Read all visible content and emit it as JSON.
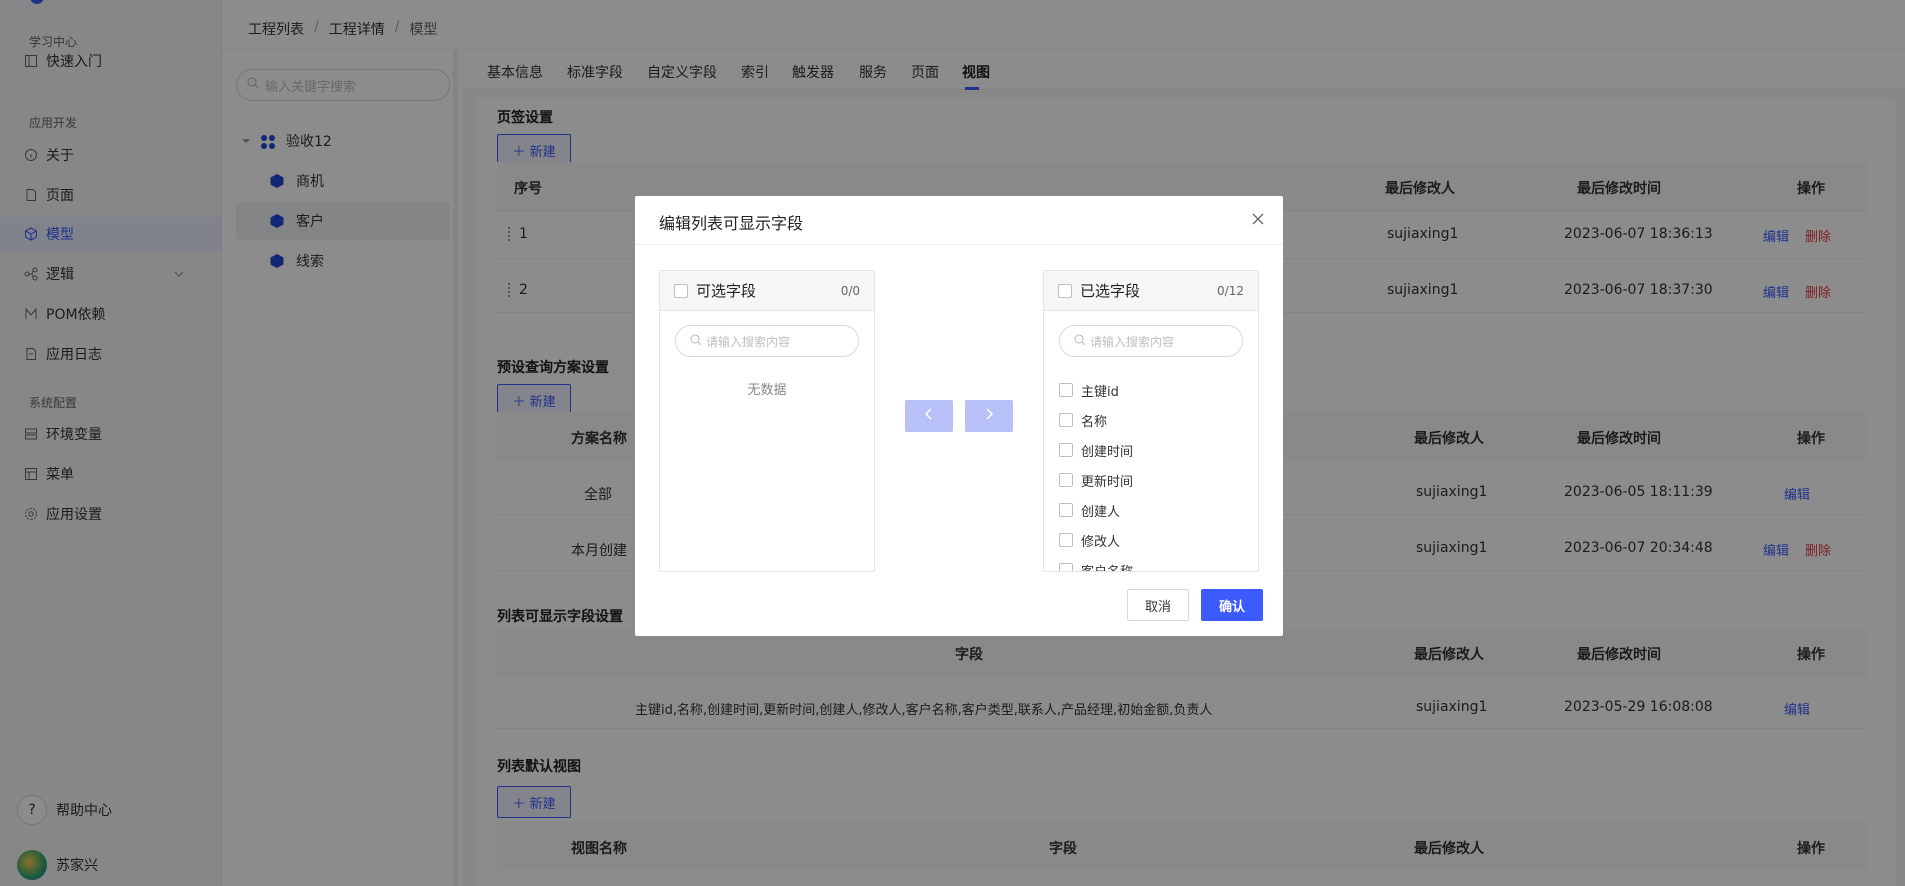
{
  "colors": {
    "accent": "#3b5bff",
    "danger": "#e63946"
  },
  "sidebar": {
    "groups": [
      {
        "label": "学习中心"
      },
      {
        "label": "应用开发"
      },
      {
        "label": "系统配置"
      }
    ],
    "items": [
      {
        "label": "快速入门",
        "icon": "book-icon"
      },
      {
        "label": "关于",
        "icon": "info-circle-icon"
      },
      {
        "label": "页面",
        "icon": "page-icon"
      },
      {
        "label": "模型",
        "icon": "cube-icon"
      },
      {
        "label": "逻辑",
        "icon": "logic-icon"
      },
      {
        "label": "POM依赖",
        "icon": "m-icon"
      },
      {
        "label": "应用日志",
        "icon": "log-icon"
      },
      {
        "label": "环境变量",
        "icon": "env-icon"
      },
      {
        "label": "菜单",
        "icon": "menu-icon"
      },
      {
        "label": "应用设置",
        "icon": "gear-icon"
      }
    ],
    "help": "帮助中心",
    "user": "苏家兴"
  },
  "breadcrumb": {
    "a": "工程列表",
    "b": "工程详情",
    "c": "模型",
    "sep": "/"
  },
  "tree": {
    "search_placeholder": "输入关键字搜索",
    "root": "验收12",
    "children": [
      "商机",
      "客户",
      "线索"
    ]
  },
  "tabs": [
    "基本信息",
    "标准字段",
    "自定义字段",
    "索引",
    "触发器",
    "服务",
    "页面",
    "视图"
  ],
  "sections": {
    "tab_settings": {
      "title": "页签设置",
      "new_btn": "新建",
      "headers": {
        "no": "序号",
        "modifier": "最后修改人",
        "time": "最后修改时间",
        "op": "操作"
      },
      "rows": [
        {
          "no": "1",
          "modifier": "sujiaxing1",
          "time": "2023-06-07 18:36:13",
          "edit": "编辑",
          "del": "删除"
        },
        {
          "no": "2",
          "modifier": "sujiaxing1",
          "time": "2023-06-07 18:37:30",
          "edit": "编辑",
          "del": "删除"
        }
      ]
    },
    "query_plans": {
      "title": "预设查询方案设置",
      "new_btn": "新建",
      "headers": {
        "name": "方案名称",
        "modifier": "最后修改人",
        "time": "最后修改时间",
        "op": "操作"
      },
      "rows": [
        {
          "name": "全部",
          "modifier": "sujiaxing1",
          "time": "2023-06-05 18:11:39",
          "edit": "编辑"
        },
        {
          "name": "本月创建",
          "modifier": "sujiaxing1",
          "time": "2023-06-07 20:34:48",
          "edit": "编辑",
          "del": "删除"
        }
      ]
    },
    "list_fields": {
      "title": "列表可显示字段设置",
      "headers": {
        "field": "字段",
        "modifier": "最后修改人",
        "time": "最后修改时间",
        "op": "操作"
      },
      "row": {
        "field": "主键id,名称,创建时间,更新时间,创建人,修改人,客户名称,客户类型,联系人,产品经理,初始金额,负责人",
        "modifier": "sujiaxing1",
        "time": "2023-05-29 16:08:08",
        "edit": "编辑"
      }
    },
    "default_view": {
      "title": "列表默认视图",
      "new_btn": "新建",
      "headers": {
        "name": "视图名称",
        "field": "字段",
        "modifier": "最后修改人",
        "op": "操作"
      }
    }
  },
  "modal": {
    "title": "编辑列表可显示字段",
    "left": {
      "title": "可选字段",
      "count": "0/0",
      "placeholder": "请输入搜索内容",
      "empty": "无数据"
    },
    "right": {
      "title": "已选字段",
      "count": "0/12",
      "placeholder": "请输入搜索内容",
      "items": [
        "主键id",
        "名称",
        "创建时间",
        "更新时间",
        "创建人",
        "修改人",
        "客户名称"
      ]
    },
    "cancel": "取消",
    "confirm": "确认"
  }
}
